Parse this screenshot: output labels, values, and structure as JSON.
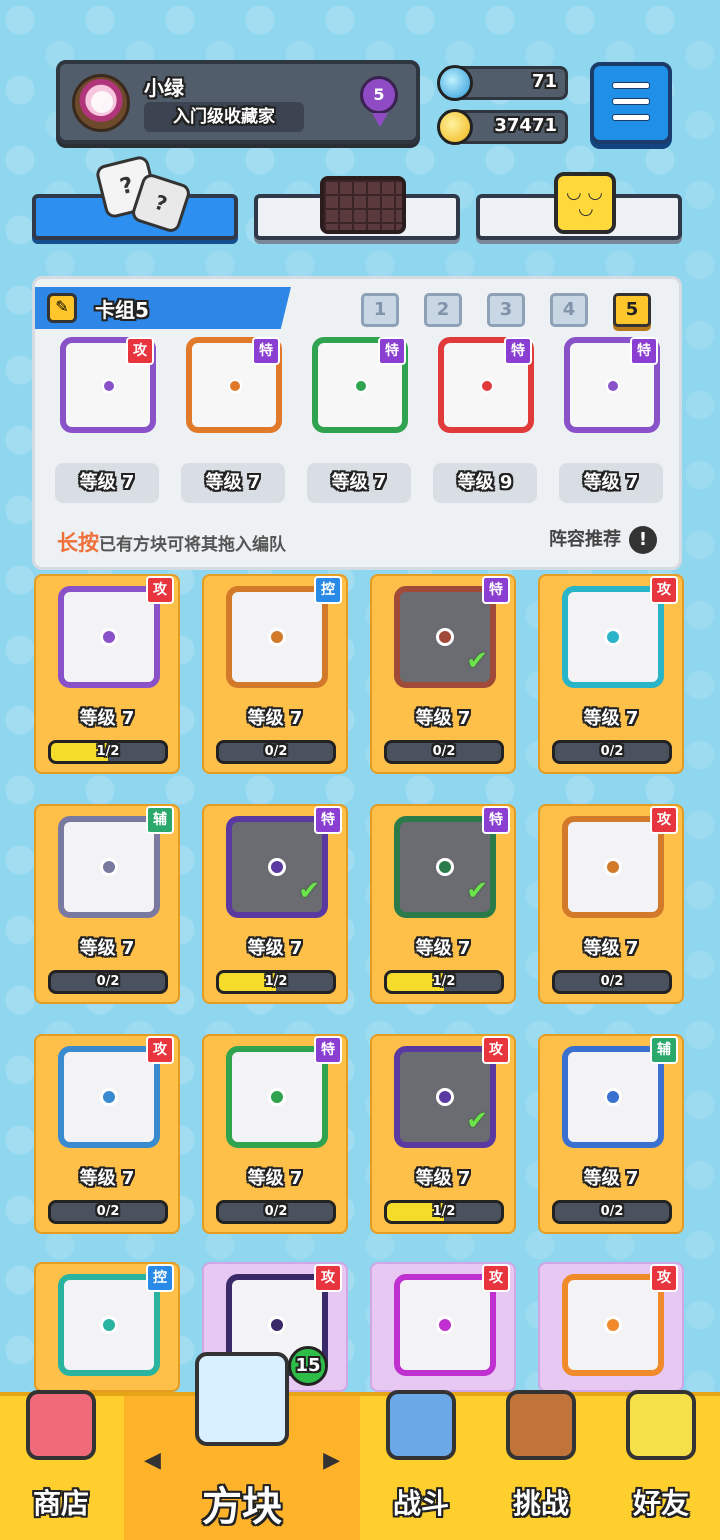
{
  "profile": {
    "name": "小绿",
    "title": "入门级收藏家",
    "rank": "5"
  },
  "currency": {
    "gems": "71",
    "coins": "37471"
  },
  "deck": {
    "label": "卡组5",
    "numbers": [
      "1",
      "2",
      "3",
      "4",
      "5"
    ],
    "slots": [
      {
        "tag": "攻",
        "level": "等级 7",
        "color": "#8a52c8"
      },
      {
        "tag": "特",
        "level": "等级 7",
        "color": "#e07a2a"
      },
      {
        "tag": "特",
        "level": "等级 7",
        "color": "#2fa34f"
      },
      {
        "tag": "特",
        "level": "等级 9",
        "color": "#e03a3a"
      },
      {
        "tag": "特",
        "level": "等级 7",
        "color": "#8a52c8"
      }
    ],
    "hint_highlight": "长按",
    "hint_rest": "已有方块可将其拖入编队",
    "recommend": "阵容推荐",
    "recommend_icon": "!"
  },
  "cards": [
    {
      "tag": "攻",
      "level": "等级 7",
      "progress": "1/2",
      "fill": 0.5,
      "color": "#8a52c8",
      "dim": false,
      "check": false
    },
    {
      "tag": "控",
      "level": "等级 7",
      "progress": "0/2",
      "fill": 0,
      "color": "#d37a2a",
      "dim": false,
      "check": false
    },
    {
      "tag": "特",
      "level": "等级 7",
      "progress": "0/2",
      "fill": 0,
      "color": "#a04a3a",
      "dim": true,
      "check": true
    },
    {
      "tag": "攻",
      "level": "等级 7",
      "progress": "0/2",
      "fill": 0,
      "color": "#2ab4c8",
      "dim": false,
      "check": false
    },
    {
      "tag": "辅",
      "level": "等级 7",
      "progress": "0/2",
      "fill": 0,
      "color": "#7a7aa0",
      "dim": false,
      "check": false
    },
    {
      "tag": "特",
      "level": "等级 7",
      "progress": "1/2",
      "fill": 0.5,
      "color": "#5a3aa0",
      "dim": true,
      "check": true
    },
    {
      "tag": "特",
      "level": "等级 7",
      "progress": "1/2",
      "fill": 0.5,
      "color": "#2a7a4a",
      "dim": true,
      "check": true
    },
    {
      "tag": "攻",
      "level": "等级 7",
      "progress": "0/2",
      "fill": 0,
      "color": "#d37a2a",
      "dim": false,
      "check": false
    },
    {
      "tag": "攻",
      "level": "等级 7",
      "progress": "0/2",
      "fill": 0,
      "color": "#3a8ad0",
      "dim": false,
      "check": false
    },
    {
      "tag": "特",
      "level": "等级 7",
      "progress": "0/2",
      "fill": 0,
      "color": "#2fa34f",
      "dim": false,
      "check": false
    },
    {
      "tag": "攻",
      "level": "等级 7",
      "progress": "1/2",
      "fill": 0.5,
      "color": "#5a3aa0",
      "dim": true,
      "check": true
    },
    {
      "tag": "辅",
      "level": "等级 7",
      "progress": "0/2",
      "fill": 0,
      "color": "#3a70d0",
      "dim": false,
      "check": false
    }
  ],
  "locked_cards": [
    {
      "tag": "控",
      "color": "#2ab4a0"
    },
    {
      "tag": "攻",
      "color": "#3a2a6a"
    },
    {
      "tag": "攻",
      "color": "#c030d0"
    },
    {
      "tag": "攻",
      "color": "#f08a2a"
    }
  ],
  "nav": {
    "shop": "商店",
    "blocks": "方块",
    "battle": "战斗",
    "challenge": "挑战",
    "friends": "好友",
    "blocks_badge": "15"
  },
  "icons": {
    "gem": "gem-icon",
    "coin": "coin-icon",
    "menu": "menu-icon",
    "dice": "dice-icon",
    "board": "board-icon",
    "emoji": "smile-icon",
    "pencil": "pencil-icon"
  }
}
